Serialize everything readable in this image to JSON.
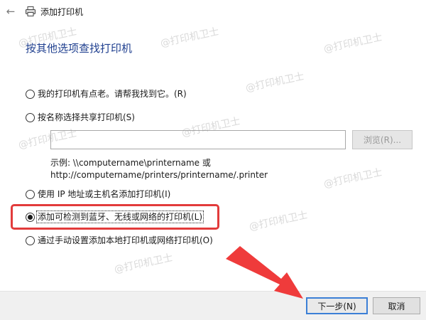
{
  "window": {
    "title": "添加打印机"
  },
  "page": {
    "title": "按其他选项查找打印机"
  },
  "options": [
    {
      "label": "我的打印机有点老。请帮我找到它。(R)",
      "checked": false
    },
    {
      "label": "按名称选择共享打印机(S)",
      "checked": false
    },
    {
      "label": "使用 IP 地址或主机名添加打印机(I)",
      "checked": false
    },
    {
      "label": "添加可检测到蓝牙、无线或网络的打印机(L)",
      "checked": true
    },
    {
      "label": "通过手动设置添加本地打印机或网络打印机(O)",
      "checked": false
    }
  ],
  "shared": {
    "value": "",
    "browse_label": "浏览(R)...",
    "example_line1": "示例: \\\\computername\\printername 或",
    "example_line2": "http://computername/printers/printername/.printer"
  },
  "buttons": {
    "next": "下一步(N)",
    "cancel": "取消"
  },
  "watermark": "@打印机卫士",
  "colors": {
    "title_blue": "#1f3f8f",
    "highlight_red": "#e23b3b",
    "default_button_border": "#3b7fd6"
  },
  "icons": {
    "back": "back-arrow-icon",
    "printer": "printer-icon"
  }
}
